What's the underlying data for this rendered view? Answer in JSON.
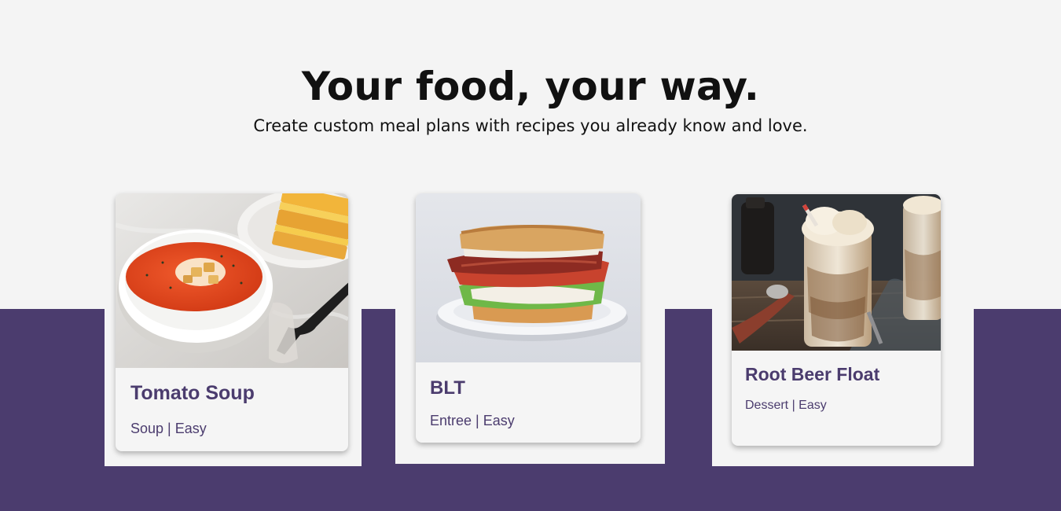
{
  "hero": {
    "title": "Your food, your way.",
    "subtitle": "Create custom meal plans with recipes you already know and love."
  },
  "recipes": [
    {
      "name": "Tomato Soup",
      "meta": "Soup | Easy",
      "image": "tomato-soup-photo"
    },
    {
      "name": "BLT",
      "meta": "Entree | Easy",
      "image": "blt-sandwich-photo"
    },
    {
      "name": "Root Beer Float",
      "meta": "Dessert | Easy",
      "image": "root-beer-float-photo"
    }
  ],
  "colors": {
    "accent": "#4b3c6e",
    "background": "#f4f4f4",
    "card": "#f5f5f5"
  }
}
